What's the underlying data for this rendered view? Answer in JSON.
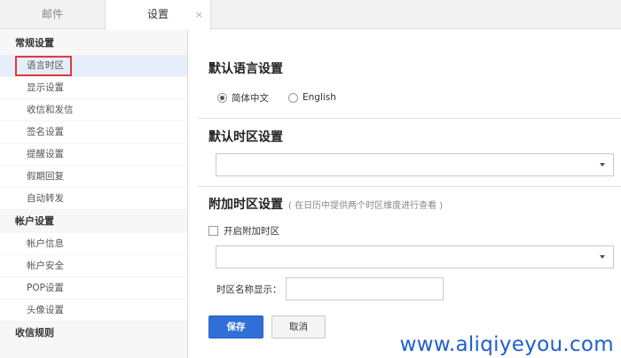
{
  "tabs": {
    "mail": "邮件",
    "settings": "设置",
    "close": "×"
  },
  "sidebar": {
    "groups": [
      {
        "title": "常规设置",
        "items": [
          "语言时区",
          "显示设置",
          "收信和发信",
          "签名设置",
          "提醒设置",
          "假期回复",
          "自动转发"
        ]
      },
      {
        "title": "帐户设置",
        "items": [
          "帐户信息",
          "帐户安全",
          "POP设置",
          "头像设置"
        ]
      },
      {
        "title": "收信规则",
        "items": []
      }
    ],
    "active_item": "语言时区"
  },
  "main": {
    "language_section": {
      "title": "默认语言设置",
      "options": [
        "简体中文",
        "English"
      ],
      "selected": "简体中文"
    },
    "timezone_section": {
      "title": "默认时区设置",
      "selected_value": ""
    },
    "extra_timezone_section": {
      "title": "附加时区设置",
      "hint": "( 在日历中提供两个时区维度进行查看 )",
      "enable_label": "开启附加时区",
      "enabled": false,
      "selected_value": "",
      "name_label": "时区名称显示：",
      "name_value": ""
    },
    "buttons": {
      "save": "保存",
      "cancel": "取消"
    }
  },
  "watermark": "www.aliqiyeyou.com",
  "colors": {
    "primary_button": "#2f6fd6",
    "highlight_box": "#e03a3a",
    "active_item_bg": "#e6eefb",
    "watermark": "#1e5fd0"
  }
}
